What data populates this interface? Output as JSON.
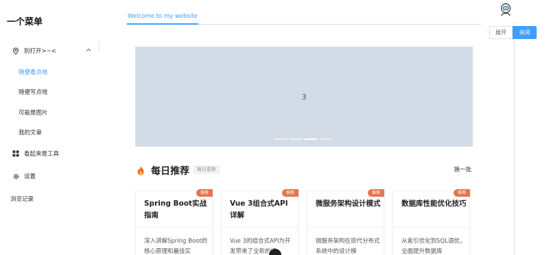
{
  "sidebar": {
    "title": "一个菜单",
    "items": [
      {
        "label": "别打开>~<",
        "icon": "location-pin-icon"
      },
      {
        "label": "随便看点啥",
        "active": true
      },
      {
        "label": "随便写点啥"
      },
      {
        "label": "可能是图片"
      },
      {
        "label": "我的文章"
      },
      {
        "label": "看起来是工具",
        "icon": "grid-icon"
      },
      {
        "label": "设置",
        "icon": "gear-icon"
      },
      {
        "label": "浏览记录"
      }
    ]
  },
  "header": {
    "tab": "Welcome to my website",
    "avatar_icon": "astronaut-avatar-icon",
    "expand_label": "展开",
    "close_label": "关闭"
  },
  "carousel": {
    "current": "3",
    "dots": [
      false,
      false,
      true,
      false
    ]
  },
  "recommend": {
    "title": "每日推荐",
    "badge": "每日更新",
    "refresh": "换一批",
    "cards": [
      {
        "tag": "推荐",
        "title": "Spring Boot实战指南",
        "desc": "深入讲解Spring Boot的核心原理和最佳实"
      },
      {
        "tag": "推荐",
        "title": "Vue 3组合式API详解",
        "desc": "Vue 3的组合式API为开发带来了全新的编"
      },
      {
        "tag": "推荐",
        "title": "微服务架构设计模式",
        "desc": "微服务架构在现代分布式系统中的设计模"
      },
      {
        "tag": "推荐",
        "title": "数据库性能优化技巧",
        "desc": "从索引优化到SQL调优，全面提升数据库"
      }
    ]
  },
  "colors": {
    "accent": "#409eff",
    "tag": "#e8744f",
    "carousel_bg": "#d3dce6"
  }
}
